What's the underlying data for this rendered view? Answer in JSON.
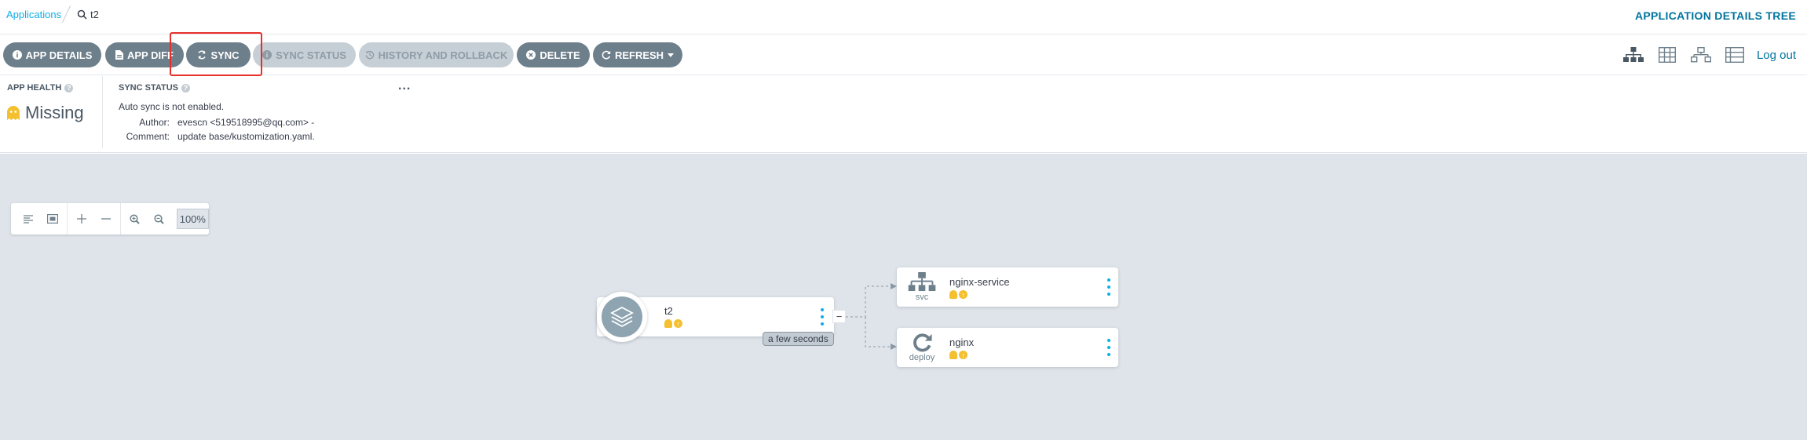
{
  "breadcrumb": {
    "applications_label": "Applications",
    "current": "t2"
  },
  "page_title": "APPLICATION DETAILS TREE",
  "toolbar": {
    "app_details": "APP DETAILS",
    "app_diff": "APP DIFF",
    "sync": "SYNC",
    "sync_status": "SYNC STATUS",
    "history_rollback": "HISTORY AND ROLLBACK",
    "delete": "DELETE",
    "refresh": "REFRESH"
  },
  "view_icons": [
    "tree-view-icon",
    "pods-view-icon",
    "network-view-icon",
    "list-view-icon"
  ],
  "logout": "Log out",
  "app_health": {
    "title": "APP HEALTH",
    "value": "Missing",
    "color": "#f4c030"
  },
  "sync_status": {
    "title": "SYNC STATUS",
    "more": "...",
    "auto_sync": "Auto sync is not enabled.",
    "author_label": "Author:",
    "author_value": "evescn <519518995@qq.com> -",
    "comment_label": "Comment:",
    "comment_value": "update base/kustomization.yaml."
  },
  "zoom": {
    "level": "100%"
  },
  "graph": {
    "app_node": {
      "name": "t2",
      "age": "a few seconds"
    },
    "resources": [
      {
        "name": "nginx-service",
        "kind": "svc"
      },
      {
        "name": "nginx",
        "kind": "deploy"
      }
    ]
  },
  "colors": {
    "accent": "#0dadea",
    "button": "#6d7f8b",
    "highlight": "#e8302a",
    "warning": "#f4c030",
    "graph_bg": "#dee4ea"
  }
}
